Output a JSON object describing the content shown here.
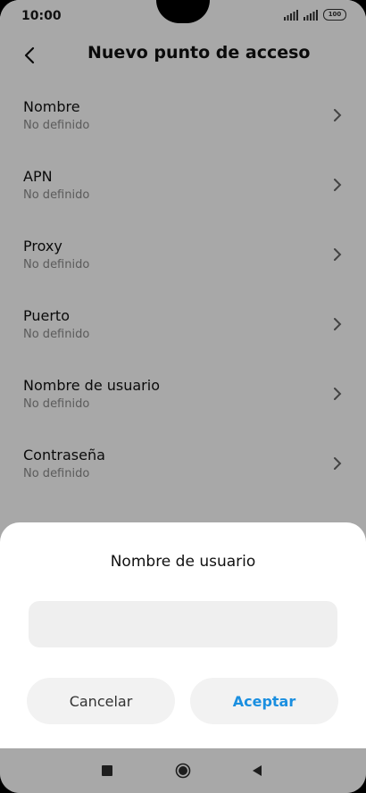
{
  "status_bar": {
    "time": "10:00",
    "battery": "100"
  },
  "header": {
    "title": "Nuevo punto de acceso",
    "back_icon": "back-arrow-icon"
  },
  "list": {
    "items": [
      {
        "label": "Nombre",
        "value": "No definido"
      },
      {
        "label": "APN",
        "value": "No definido"
      },
      {
        "label": "Proxy",
        "value": "No definido"
      },
      {
        "label": "Puerto",
        "value": "No definido"
      },
      {
        "label": "Nombre de usuario",
        "value": "No definido"
      },
      {
        "label": "Contraseña",
        "value": "No definido"
      }
    ]
  },
  "dialog": {
    "title": "Nombre de usuario",
    "input_value": "",
    "cancel_label": "Cancelar",
    "accept_label": "Aceptar",
    "accent_color": "#1a8fe0"
  },
  "nav": {
    "recents_icon": "square-recents-icon",
    "home_icon": "circle-home-icon",
    "back_icon": "triangle-back-icon"
  }
}
